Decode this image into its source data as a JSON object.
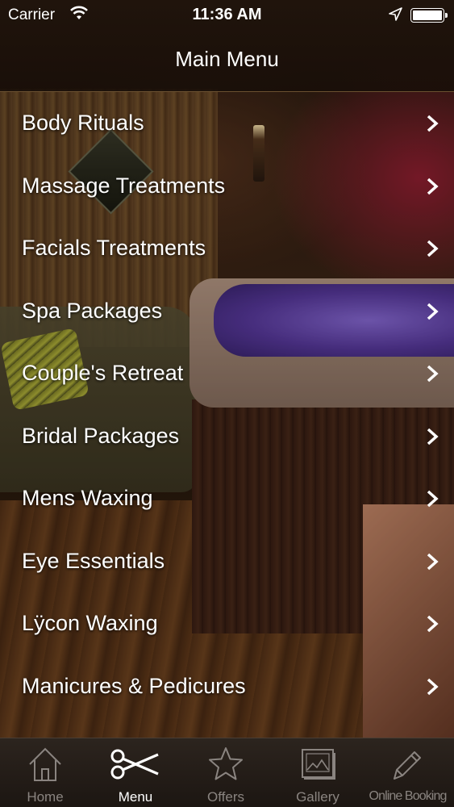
{
  "status_bar": {
    "carrier": "Carrier",
    "time": "11:36 AM",
    "icons": [
      "wifi-icon",
      "location-arrow-icon",
      "battery-icon"
    ]
  },
  "nav": {
    "title": "Main Menu"
  },
  "menu": {
    "items": [
      {
        "label": "Body Rituals",
        "icon": "chevron-right-icon"
      },
      {
        "label": "Massage Treatments",
        "icon": "chevron-right-icon"
      },
      {
        "label": "Facials Treatments",
        "icon": "chevron-right-icon"
      },
      {
        "label": "Spa Packages",
        "icon": "chevron-right-icon"
      },
      {
        "label": "Couple's Retreat",
        "icon": "chevron-right-icon"
      },
      {
        "label": "Bridal Packages",
        "icon": "chevron-right-icon"
      },
      {
        "label": "Mens Waxing",
        "icon": "chevron-right-icon"
      },
      {
        "label": "Eye Essentials",
        "icon": "chevron-right-icon"
      },
      {
        "label": "Lÿcon Waxing",
        "icon": "chevron-right-icon"
      },
      {
        "label": "Manicures & Pedicures",
        "icon": "chevron-right-icon"
      }
    ]
  },
  "tab_bar": {
    "active": "Menu",
    "tabs": [
      {
        "label": "Home",
        "icon": "house-icon"
      },
      {
        "label": "Menu",
        "icon": "scissors-icon"
      },
      {
        "label": "Offers",
        "icon": "star-icon"
      },
      {
        "label": "Gallery",
        "icon": "picture-icon"
      },
      {
        "label": "Online Booking",
        "icon": "pencil-icon"
      }
    ]
  },
  "colors": {
    "text": "#ffffff",
    "tab_inactive": "#8a8480",
    "tab_active": "#ffffff",
    "nav_background": "#20140c"
  }
}
